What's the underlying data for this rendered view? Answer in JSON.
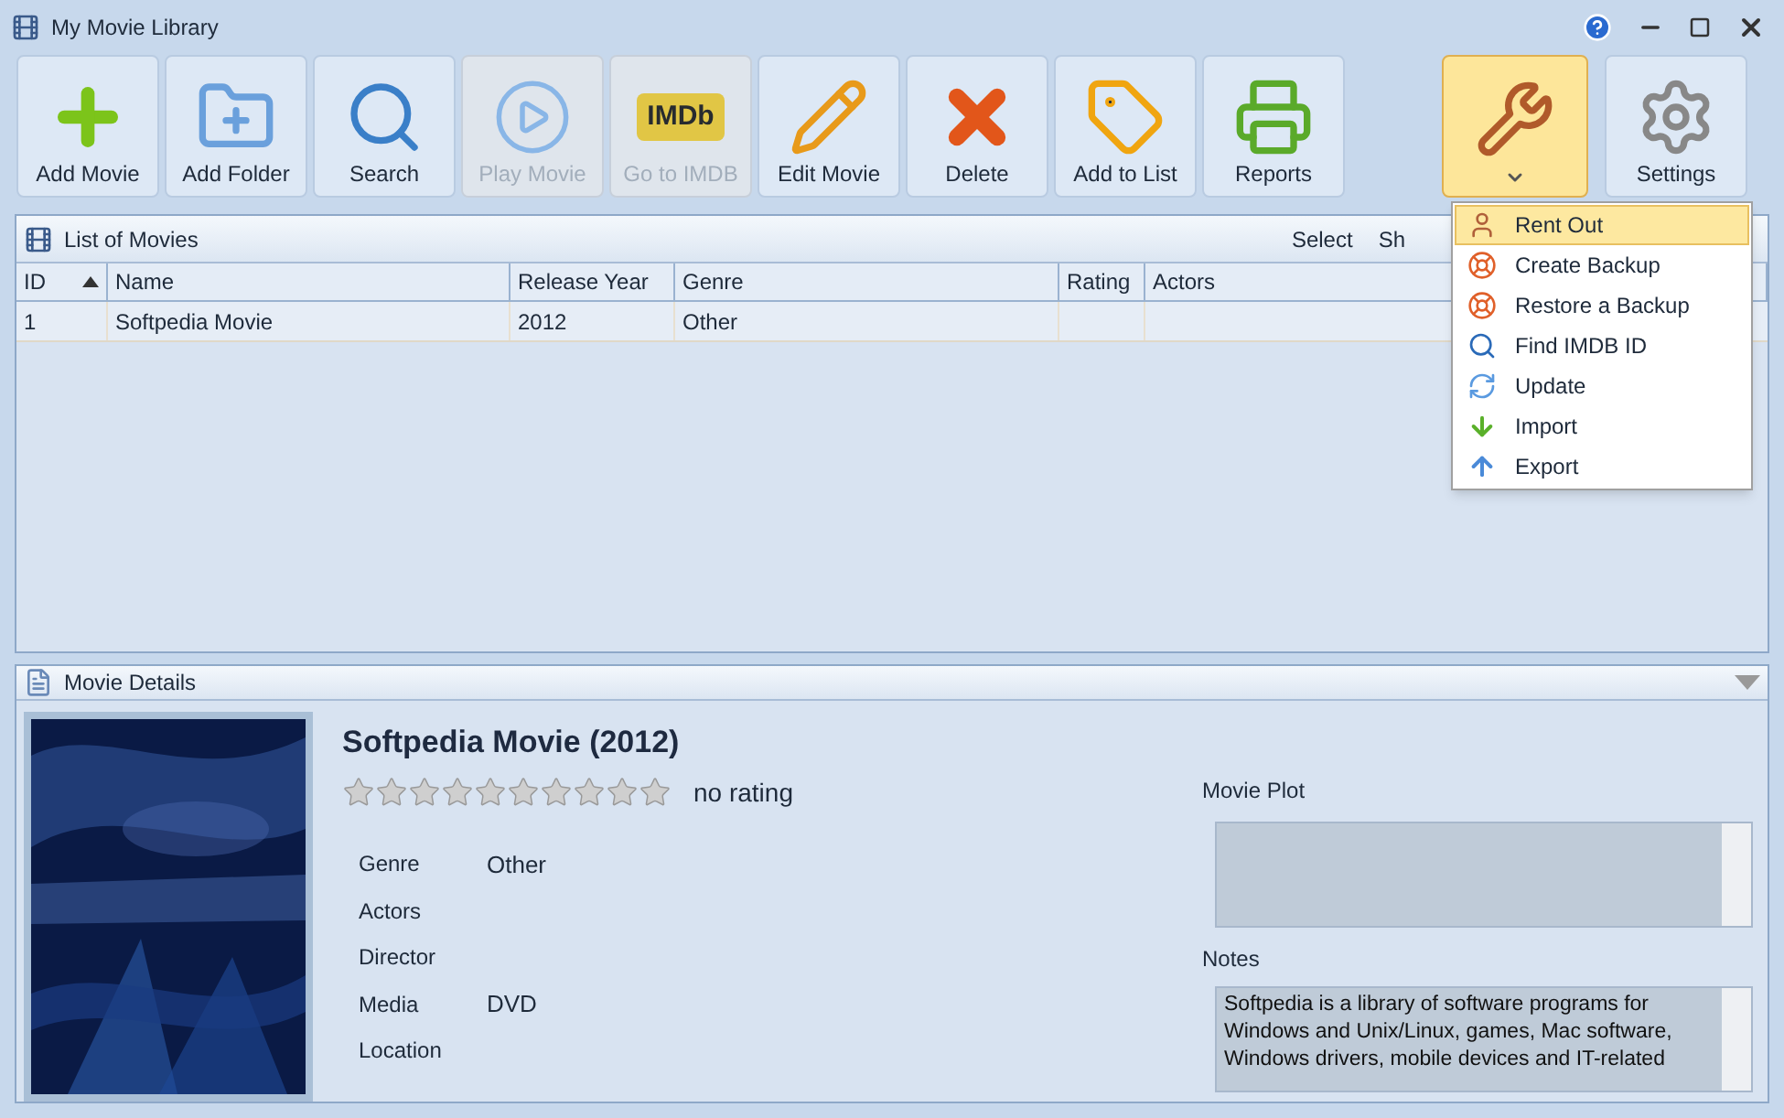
{
  "window": {
    "title": "My Movie Library"
  },
  "toolbar": [
    {
      "label": "Add Movie",
      "kind": "add",
      "disabled": false
    },
    {
      "label": "Add Folder",
      "kind": "folder",
      "disabled": false
    },
    {
      "label": "Search",
      "kind": "search",
      "disabled": false
    },
    {
      "label": "Play Movie",
      "kind": "play",
      "disabled": true
    },
    {
      "label": "Go to IMDB",
      "kind": "imdb",
      "logo": "IMDb",
      "disabled": true
    },
    {
      "label": "Edit Movie",
      "kind": "edit",
      "disabled": false
    },
    {
      "label": "Delete",
      "kind": "delete",
      "disabled": false
    },
    {
      "label": "Add to List",
      "kind": "tag",
      "disabled": false
    },
    {
      "label": "Reports",
      "kind": "print",
      "disabled": false
    }
  ],
  "tools_button": {
    "open": true
  },
  "settings_button": {
    "label": "Settings"
  },
  "list_panel": {
    "title": "List of Movies",
    "actions": [
      "Select",
      "Sh"
    ],
    "columns": [
      {
        "label": "ID",
        "sorted": true
      },
      {
        "label": "Name",
        "sorted": false
      },
      {
        "label": "Release Year",
        "sorted": false
      },
      {
        "label": "Genre",
        "sorted": false
      },
      {
        "label": "Rating",
        "sorted": false
      },
      {
        "label": "Actors",
        "sorted": false
      }
    ],
    "rows": [
      {
        "cells": [
          "1",
          "Softpedia Movie",
          "2012",
          "Other",
          ""
        ],
        "selected": true
      }
    ]
  },
  "tools_menu": [
    {
      "label": "Rent Out",
      "kind": "person",
      "selected": true
    },
    {
      "label": "Create Backup",
      "kind": "buoy",
      "selected": false
    },
    {
      "label": "Restore a Backup",
      "kind": "buoy",
      "selected": false
    },
    {
      "label": "Find IMDB ID",
      "kind": "search",
      "selected": false
    },
    {
      "label": "Update",
      "kind": "refresh",
      "selected": false
    },
    {
      "label": "Import",
      "kind": "down",
      "selected": false
    },
    {
      "label": "Export",
      "kind": "up",
      "selected": false
    }
  ],
  "details_panel": {
    "title": "Movie Details",
    "heading": "Softpedia Movie (2012)",
    "stars": 0,
    "rating_text": "no rating",
    "fields": [
      {
        "label": "Genre",
        "value": "Other"
      },
      {
        "label": "Actors"
      },
      {
        "label": "Director"
      },
      {
        "label": "Media",
        "value": "DVD"
      },
      {
        "label": "Location"
      }
    ],
    "plot": {
      "label": "Movie Plot"
    },
    "notes": {
      "label": "Notes",
      "value": "Softpedia is a library of software programs for Windows and Unix/Linux, games, Mac software, Windows drivers, mobile devices and IT-related"
    }
  }
}
